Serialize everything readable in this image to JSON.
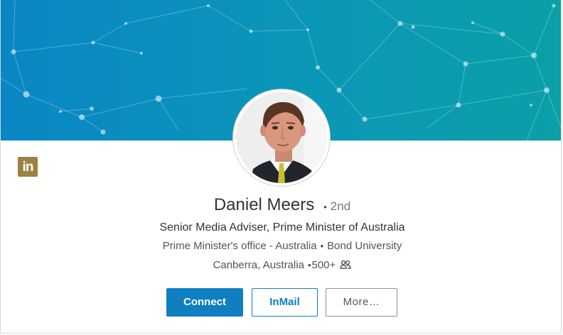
{
  "profile": {
    "name": "Daniel Meers",
    "degree": "2nd",
    "headline": "Senior Media Adviser, Prime Minister of Australia",
    "company": "Prime Minister's office - Australia",
    "education": "Bond University",
    "location": "Canberra, Australia",
    "connections": "500+"
  },
  "badge": {
    "label": "in",
    "icon": "linkedin-icon"
  },
  "actions": {
    "connect": "Connect",
    "inmail": "InMail",
    "more": "More…"
  },
  "icons": {
    "connections": "people-icon",
    "avatar": "avatar-photo"
  },
  "colors": {
    "accent": "#0f7fc0",
    "badge": "#9c8144",
    "banner_start": "#0a86c4",
    "banner_end": "#0aa0a6"
  }
}
